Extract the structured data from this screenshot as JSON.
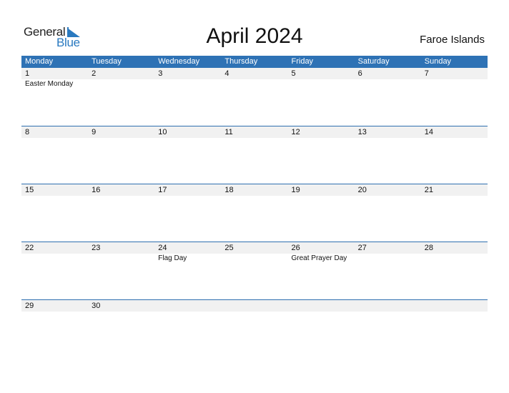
{
  "logo": {
    "general": "General",
    "blue": "Blue"
  },
  "header": {
    "title": "April 2024",
    "country": "Faroe Islands"
  },
  "colors": {
    "accent": "#2e72b5",
    "date_row_bg": "#f1f1f1"
  },
  "weekdays": [
    "Monday",
    "Tuesday",
    "Wednesday",
    "Thursday",
    "Friday",
    "Saturday",
    "Sunday"
  ],
  "weeks": [
    {
      "days": [
        "1",
        "2",
        "3",
        "4",
        "5",
        "6",
        "7"
      ],
      "holidays": [
        "Easter Monday",
        "",
        "",
        "",
        "",
        "",
        ""
      ]
    },
    {
      "days": [
        "8",
        "9",
        "10",
        "11",
        "12",
        "13",
        "14"
      ],
      "holidays": [
        "",
        "",
        "",
        "",
        "",
        "",
        ""
      ]
    },
    {
      "days": [
        "15",
        "16",
        "17",
        "18",
        "19",
        "20",
        "21"
      ],
      "holidays": [
        "",
        "",
        "",
        "",
        "",
        "",
        ""
      ]
    },
    {
      "days": [
        "22",
        "23",
        "24",
        "25",
        "26",
        "27",
        "28"
      ],
      "holidays": [
        "",
        "",
        "Flag Day",
        "",
        "Great Prayer Day",
        "",
        ""
      ]
    },
    {
      "days": [
        "29",
        "30",
        "",
        "",
        "",
        "",
        ""
      ],
      "holidays": [
        "",
        "",
        "",
        "",
        "",
        "",
        ""
      ]
    }
  ]
}
